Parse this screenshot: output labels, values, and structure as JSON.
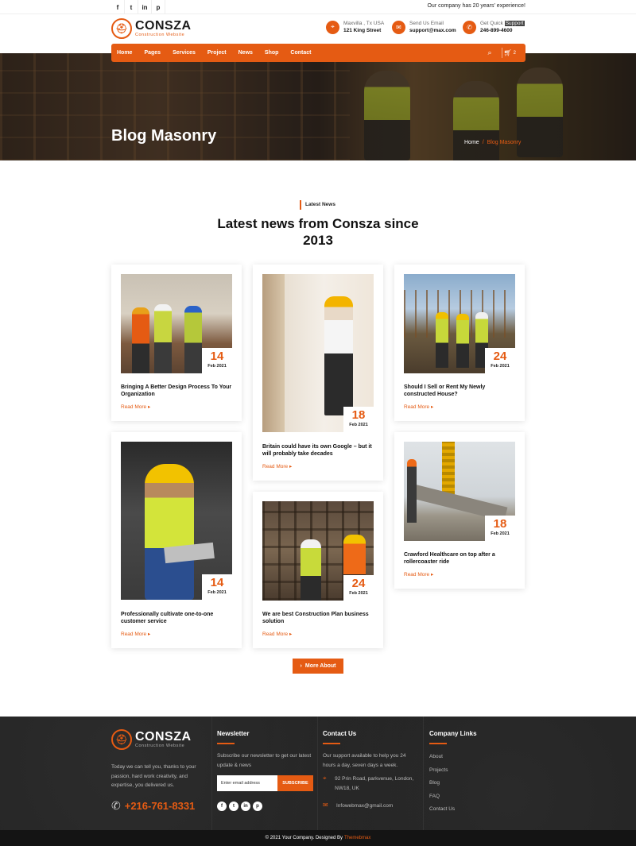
{
  "topbar": {
    "social": [
      "f",
      "t",
      "in",
      "p"
    ],
    "message": "Our company has 20 years' experience!"
  },
  "header": {
    "logo_name": "CONSZA",
    "logo_sub": "Construction Website",
    "location_label": "Maxvilla , Tx USA",
    "location_value": "121 King Street",
    "email_label": "Send Us Email",
    "email_value": "support@max.com",
    "support_label": "Get Quick",
    "support_highlight": "Support",
    "support_value": "246-899-4600"
  },
  "nav": {
    "items": [
      "Home",
      "Pages",
      "Services",
      "Project",
      "News",
      "Shop",
      "Contact"
    ],
    "cart_count": "2"
  },
  "hero": {
    "title": "Blog Masonry",
    "crumb_home": "Home",
    "crumb_sep": "/",
    "crumb_current": "Blog Masonry"
  },
  "section": {
    "tag": "Latest News",
    "title": "Latest news from Consza since 2013"
  },
  "posts": [
    {
      "day": "14",
      "month": "Feb 2021",
      "title": "Bringing A Better Design Process To Your Organization",
      "read_more": "Read More"
    },
    {
      "day": "18",
      "month": "Feb 2021",
      "title": "Britain could have its own Google – but it will probably take decades",
      "read_more": "Read More"
    },
    {
      "day": "24",
      "month": "Feb 2021",
      "title": "Should I Sell or Rent My Newly constructed House?",
      "read_more": "Read More"
    },
    {
      "day": "14",
      "month": "Feb 2021",
      "title": "Professionally cultivate one-to-one customer service",
      "read_more": "Read More"
    },
    {
      "day": "24",
      "month": "Feb 2021",
      "title": "We are best Construction Plan business solution",
      "read_more": "Read More"
    },
    {
      "day": "18",
      "month": "Feb 2021",
      "title": "Crawford Healthcare on top after a rollercoaster ride",
      "read_more": "Read More"
    }
  ],
  "more_button": "More About",
  "footer": {
    "logo_name": "CONSZA",
    "logo_sub": "Construction Website",
    "about": "Today we can tell you, thanks to your passion, hard work creativity, and expertise, you delivered us.",
    "phone": "+216-761-8331",
    "newsletter_title": "Newsletter",
    "newsletter_text": "Subscribe our newsletter to get our latest update & news",
    "email_placeholder": "Enter email address",
    "subscribe": "SUBSCRIBE",
    "social": [
      "f",
      "t",
      "in",
      "p"
    ],
    "contact_title": "Contact Us",
    "contact_text": "Our support available to help you 24 hours a day, seven days a week.",
    "address": "92 Prin Road, parkvenue, London, NW18, UK",
    "email": "Infowebmax@gmail.com",
    "links_title": "Company Links",
    "links": [
      "About",
      "Projects",
      "Blog",
      "FAQ",
      "Contact Us"
    ]
  },
  "bottom": {
    "copyright": "© 2021 Your Company. Designed By",
    "brand": "Themebmax"
  },
  "colors": {
    "accent": "#e55b13",
    "footer_bg": "#222222"
  }
}
